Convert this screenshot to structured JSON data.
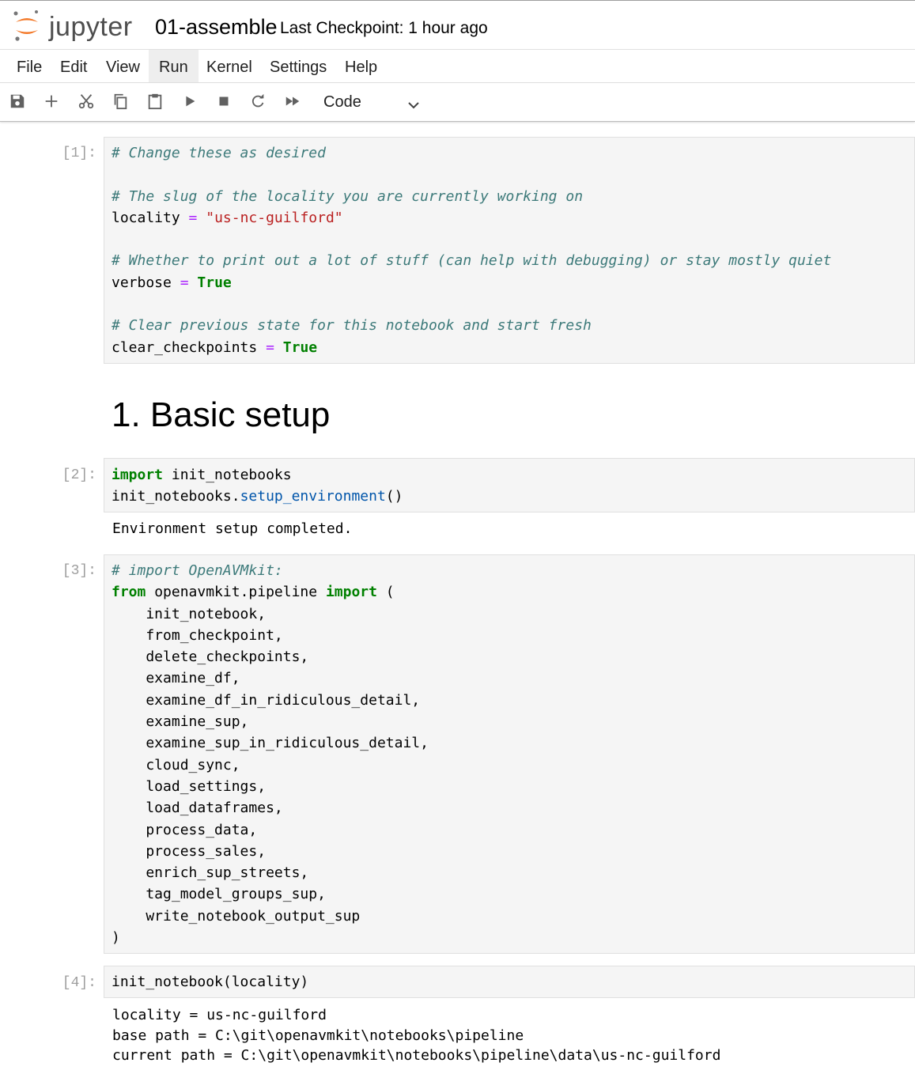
{
  "header": {
    "logo_text": "jupyter",
    "notebook_title": "01-assemble",
    "checkpoint": "Last Checkpoint: 1 hour ago"
  },
  "menu": {
    "items": [
      {
        "label": "File"
      },
      {
        "label": "Edit"
      },
      {
        "label": "View"
      },
      {
        "label": "Run"
      },
      {
        "label": "Kernel"
      },
      {
        "label": "Settings"
      },
      {
        "label": "Help"
      }
    ],
    "active": "Run"
  },
  "toolbar": {
    "icons": [
      "save-icon",
      "add-cell-icon",
      "cut-icon",
      "copy-icon",
      "paste-icon",
      "run-icon",
      "stop-icon",
      "restart-icon",
      "fast-forward-icon"
    ],
    "cell_type": "Code"
  },
  "cells": {
    "c1": {
      "prompt": "[1]:",
      "lines": [
        "# Change these as desired",
        "",
        "# The slug of the locality you are currently working on",
        "locality = \"us-nc-guilford\"",
        "",
        "# Whether to print out a lot of stuff (can help with debugging) or stay mostly quiet",
        "verbose = True",
        "",
        "# Clear previous state for this notebook and start fresh",
        "clear_checkpoints = True"
      ]
    },
    "md1": {
      "heading": "1. Basic setup"
    },
    "c2": {
      "prompt": "[2]:",
      "lines": [
        "import init_notebooks",
        "init_notebooks.setup_environment()"
      ],
      "output": [
        "Environment setup completed."
      ]
    },
    "c3": {
      "prompt": "[3]:",
      "lines": [
        "# import OpenAVMkit:",
        "from openavmkit.pipeline import (",
        "    init_notebook,",
        "    from_checkpoint,",
        "    delete_checkpoints,",
        "    examine_df,",
        "    examine_df_in_ridiculous_detail,",
        "    examine_sup,",
        "    examine_sup_in_ridiculous_detail,",
        "    cloud_sync,",
        "    load_settings,",
        "    load_dataframes,",
        "    process_data,",
        "    process_sales,",
        "    enrich_sup_streets,",
        "    tag_model_groups_sup,",
        "    write_notebook_output_sup",
        ")"
      ]
    },
    "c4": {
      "prompt": "[4]:",
      "lines": [
        "init_notebook(locality)"
      ],
      "output": [
        "locality = us-nc-guilford",
        "base path = C:\\git\\openavmkit\\notebooks\\pipeline",
        "current path = C:\\git\\openavmkit\\notebooks\\pipeline\\data\\us-nc-guilford"
      ]
    }
  },
  "colors": {
    "comment": "#3d7a7a",
    "keyword": "#008000",
    "string": "#ba2121",
    "operator": "#aa22ff",
    "function": "#0055aa",
    "logo_orange": "#f37726"
  }
}
